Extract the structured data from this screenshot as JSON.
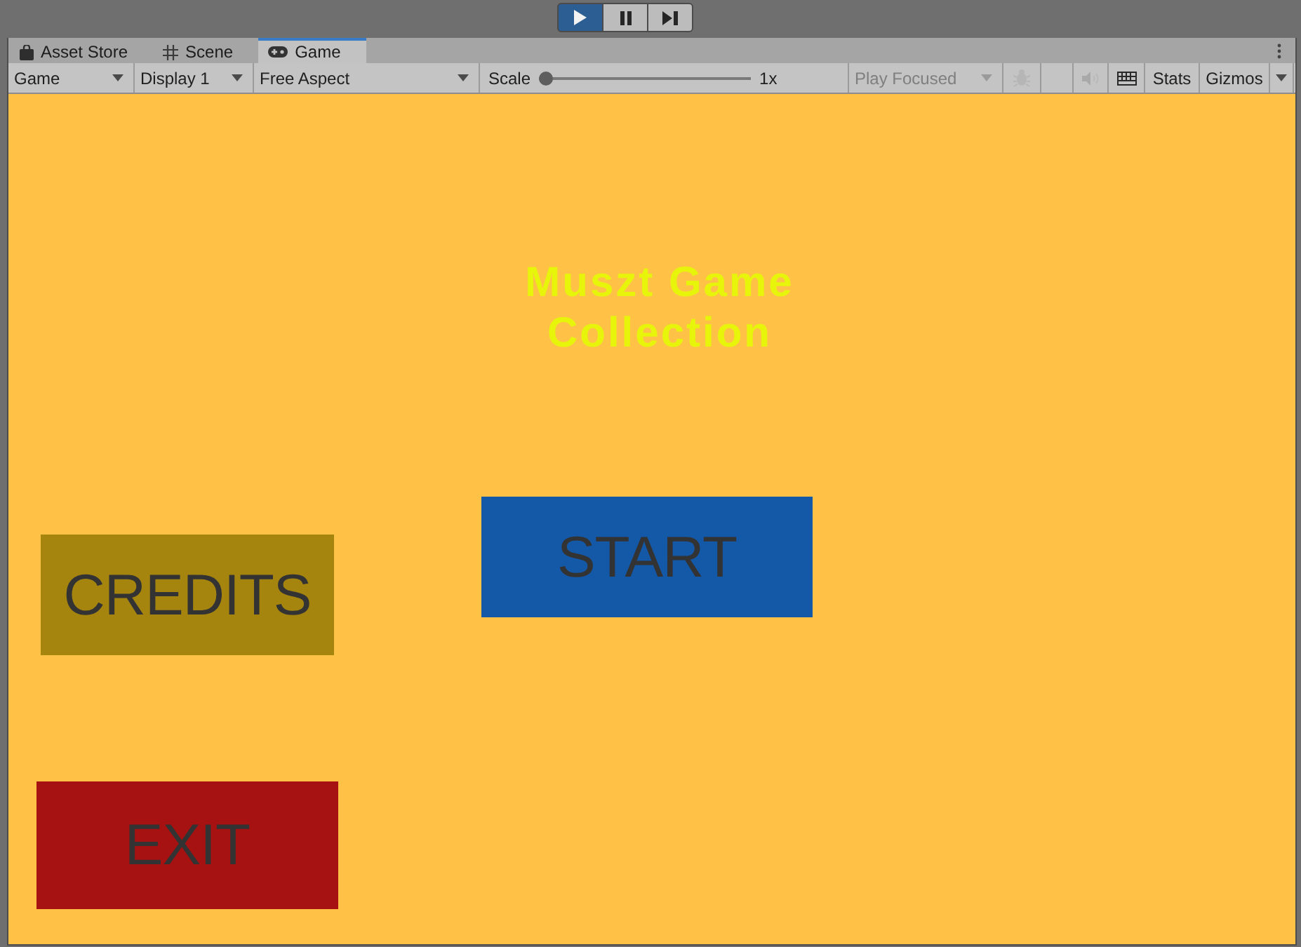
{
  "play_controls": [
    {
      "kind": "play",
      "selected": true
    },
    {
      "kind": "pause",
      "selected": false
    },
    {
      "kind": "step",
      "selected": false
    }
  ],
  "tabs": [
    {
      "kind": "store",
      "label": "Asset Store",
      "selected": false
    },
    {
      "kind": "scene",
      "label": "Scene",
      "selected": false
    },
    {
      "kind": "game",
      "label": "Game",
      "selected": true
    }
  ],
  "toolbar": {
    "view_mode": "Game",
    "display": "Display 1",
    "aspect": "Free Aspect",
    "scale": {
      "label": "Scale",
      "level": 0,
      "reading": "1x"
    },
    "play_mode": {
      "label": "Play Focused",
      "disabled": true
    },
    "stats": "Stats",
    "gizmos": "Gizmos"
  },
  "game_view": {
    "title": "Muszt Game Collection",
    "buttons": [
      {
        "label": "START",
        "color": "#1458a8"
      },
      {
        "label": "CREDITS",
        "color": "#a6850f"
      },
      {
        "label": "EXIT",
        "color": "#a61212"
      }
    ]
  }
}
